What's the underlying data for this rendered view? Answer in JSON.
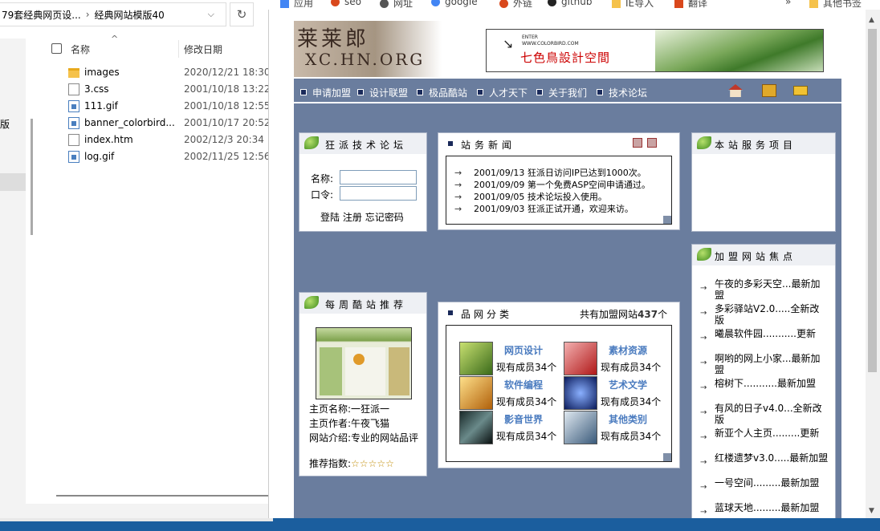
{
  "explorer": {
    "breadcrumb": [
      "79套经典网页设...",
      "经典网站模版40"
    ],
    "refresh_icon": "refresh-icon",
    "nav_partial_label": "版",
    "columns": {
      "name": "名称",
      "date": "修改日期"
    },
    "files": [
      {
        "name": "images",
        "date": "2020/12/21 18:30",
        "icon": "folder-icon"
      },
      {
        "name": "3.css",
        "date": "2001/10/18 13:22",
        "icon": "css-file-icon"
      },
      {
        "name": "111.gif",
        "date": "2001/10/18 12:55",
        "icon": "gif-file-icon"
      },
      {
        "name": "banner_colorbird...",
        "date": "2001/10/17 20:52",
        "icon": "gif-file-icon"
      },
      {
        "name": "index.htm",
        "date": "2002/12/3 20:34",
        "icon": "html-file-icon"
      },
      {
        "name": "log.gif",
        "date": "2002/11/25 12:56",
        "icon": "gif-file-icon"
      }
    ]
  },
  "bookmarks": [
    {
      "label": "应用",
      "icon": "apps-grid-icon",
      "color": "#4285f4"
    },
    {
      "label": "seo",
      "icon": "seo-icon",
      "color": "#d9481c"
    },
    {
      "label": "网址",
      "icon": "url-icon",
      "color": "#555555"
    },
    {
      "label": "google",
      "icon": "google-icon",
      "color": "#4285f4"
    },
    {
      "label": "外链",
      "icon": "backlink-icon",
      "color": "#d9481c"
    },
    {
      "label": "github",
      "icon": "github-icon",
      "color": "#222222"
    },
    {
      "label": "IE导入",
      "icon": "folder-icon",
      "color": "#f5c24b"
    },
    {
      "label": "翻译",
      "icon": "translate-icon",
      "color": "#d9481c"
    }
  ],
  "bookmarks_more": "»",
  "bookmarks_other": "其他书签",
  "site": {
    "logo_cn": "莱莱郎",
    "logo_en": "XC.HN.ORG",
    "ad": {
      "enter": "ENTER",
      "url": "WWW.COLORBIRD.COM",
      "title": "七色鳥設計空間"
    },
    "menu": [
      "申请加盟",
      "设计联盟",
      "极品酷站",
      "人才天下",
      "关于我们",
      "技术论坛"
    ],
    "tools": [
      {
        "icon": "home-icon",
        "color": "#c0392b"
      },
      {
        "icon": "favorite-folder-icon",
        "color": "#e0a92a"
      },
      {
        "icon": "mail-icon",
        "color": "#f1c232"
      }
    ],
    "forum": {
      "title": "狂派技术论坛",
      "name_label": "名称:",
      "pass_label": "口令:",
      "actions": [
        "登陆",
        "注册",
        "忘记密码"
      ]
    },
    "news": {
      "title": "站务新闻",
      "items": [
        {
          "date": "2001/09/13",
          "text": "狂派日访问IP已达到1000次。"
        },
        {
          "date": "2001/09/09",
          "text": "第一个免费ASP空间申请通过。"
        },
        {
          "date": "2001/09/05",
          "text": "技术论坛投入使用。"
        },
        {
          "date": "2001/09/03",
          "text": "狂派正试开通，欢迎来访。"
        }
      ]
    },
    "service": {
      "title": "本站服务项目"
    },
    "weekly": {
      "title": "每周酷站推荐",
      "home_name": "主页名称:一狂派一",
      "author": "主页作者:午夜飞猫",
      "intro": "网站介绍:专业的网站品评",
      "rating_label": "推荐指数:",
      "stars": "☆☆☆☆☆"
    },
    "category": {
      "title": "品网分类",
      "total_prefix": "共有加盟网站",
      "total": "437",
      "total_suffix": "个",
      "items": [
        {
          "name": "网页设计",
          "members": "现有成员34个",
          "color": "#6a9a2a"
        },
        {
          "name": "素材资源",
          "members": "现有成员34个",
          "color": "#c03030"
        },
        {
          "name": "软件编程",
          "members": "现有成员34个",
          "color": "#d88a1a"
        },
        {
          "name": "艺术文学",
          "members": "现有成员34个",
          "color": "#1a3a8a"
        },
        {
          "name": "影音世界",
          "members": "现有成员34个",
          "color": "#203040"
        },
        {
          "name": "其他类别",
          "members": "现有成员34个",
          "color": "#6a8aa8"
        }
      ]
    },
    "focus": {
      "title": "加盟网站焦点",
      "items": [
        "午夜的多彩天空...最新加盟",
        "多彩驿站V2.0.....全新改版",
        "曦晨软件园...........更新",
        "啊哟的网上小家...最新加盟",
        "榕树下...........最新加盟",
        "有风的日子v4.0...全新改版",
        "新亚个人主页.........更新",
        "红楼遗梦v3.0.....最新加盟",
        "一号空间.........最新加盟",
        "蓝球天地.........最新加盟"
      ]
    }
  }
}
